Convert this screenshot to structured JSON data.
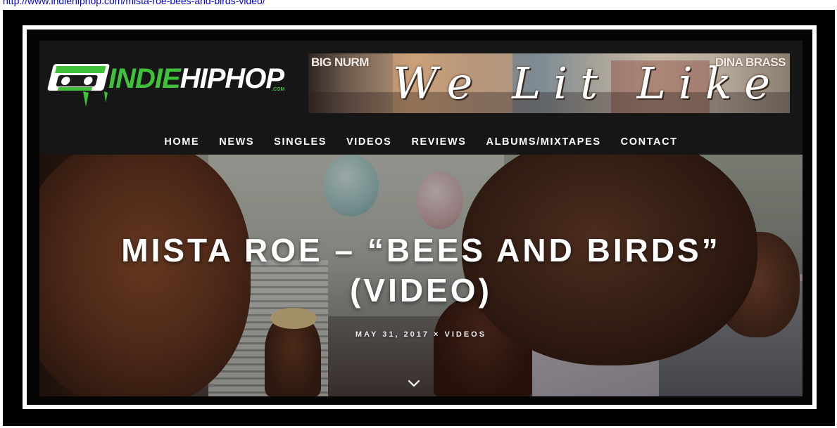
{
  "top_link": {
    "text": "http://www.indiehiphop.com/mista-roe-bees-and-birds-video/"
  },
  "site": {
    "logo": {
      "part1": "INDIE",
      "part2": "HIPHOP",
      "suffix": ".COM"
    },
    "banner": {
      "left_text": "BIG NURM",
      "script_text": "We Lit Like",
      "right_text": "DINA BRASS"
    },
    "nav": [
      "HOME",
      "NEWS",
      "SINGLES",
      "VIDEOS",
      "REVIEWS",
      "ALBUMS/MIXTAPES",
      "CONTACT"
    ]
  },
  "hero": {
    "title_line1": "MISTA ROE – “BEES AND BIRDS”",
    "title_line2": "(VIDEO)",
    "date": "MAY 31, 2017",
    "separator": "×",
    "category": "VIDEOS",
    "scroll_icon": "chevron-down-icon"
  },
  "colors": {
    "brand_green": "#3fc13a",
    "header_bg": "#161616",
    "link_blue": "#0000ee"
  }
}
